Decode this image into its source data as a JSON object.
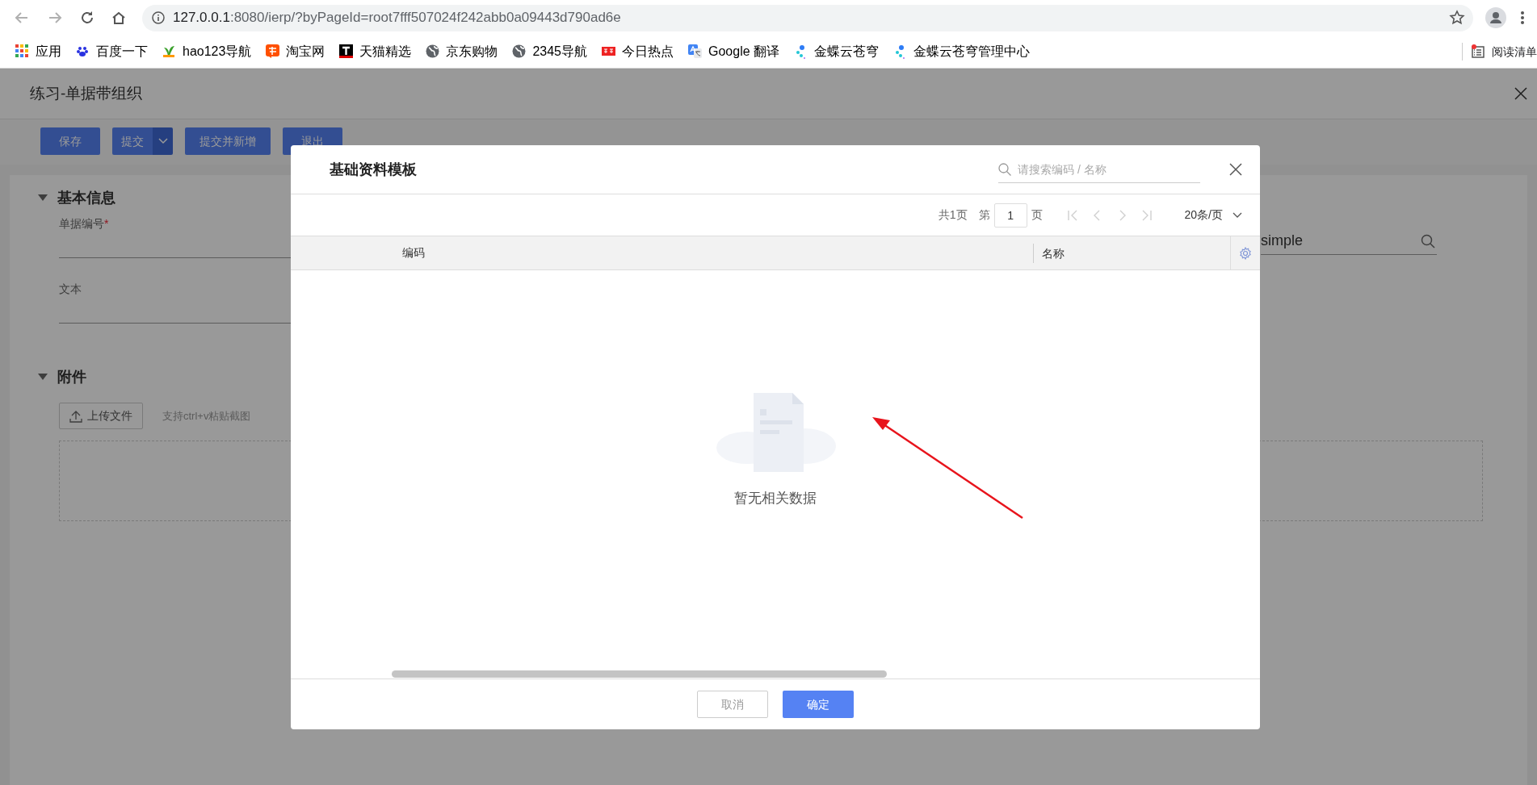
{
  "browser": {
    "url_host": "127.0.0.1",
    "url_rest": ":8080/ierp/?byPageId=root7fff507024f242abb0a09443d790ad6e",
    "bookmarks": [
      {
        "label": "应用",
        "kind": "grid"
      },
      {
        "label": "百度一下",
        "kind": "paw"
      },
      {
        "label": "hao123导航",
        "kind": "leaf"
      },
      {
        "label": "淘宝网",
        "kind": "orange"
      },
      {
        "label": "天猫精选",
        "kind": "black"
      },
      {
        "label": "京东购物",
        "kind": "globe"
      },
      {
        "label": "2345导航",
        "kind": "globe"
      },
      {
        "label": "今日热点",
        "kind": "red"
      },
      {
        "label": "Google 翻译",
        "kind": "translate"
      },
      {
        "label": "金蝶云苍穹",
        "kind": "dots"
      },
      {
        "label": "金蝶云苍穹管理中心",
        "kind": "dots"
      }
    ],
    "reading_list": "阅读清单"
  },
  "page": {
    "title": "练习-单据带组织",
    "toolbar": [
      {
        "label": "保存",
        "kind": "button"
      },
      {
        "label": "提交",
        "kind": "split"
      },
      {
        "label": "提交并新增",
        "kind": "button"
      },
      {
        "label": "退出",
        "kind": "button"
      }
    ],
    "sections": [
      {
        "title": "基本信息",
        "expanded": true,
        "fields": [
          {
            "label": "单据编号",
            "required_mark": "*"
          },
          {
            "label": "文本"
          }
        ],
        "side_value": "simple"
      },
      {
        "title": "附件",
        "expanded": true,
        "upload_button": "上传文件",
        "paste_hint": "支持ctrl+v粘贴截图"
      }
    ]
  },
  "dialog": {
    "title": "基础资料模板",
    "search": {
      "placeholder": "请搜索编码 / 名称"
    },
    "pager": {
      "total": "共1页",
      "page_prefix": "第",
      "page": "1",
      "page_suffix": "页",
      "navigation_disabled": true,
      "page_size": "20条/页"
    },
    "columns": [
      "编码",
      "名称"
    ],
    "empty_text": "暂无相关数据",
    "buttons": [
      {
        "label": "取消",
        "kind": "secondary"
      },
      {
        "label": "确定",
        "kind": "primary"
      }
    ]
  }
}
